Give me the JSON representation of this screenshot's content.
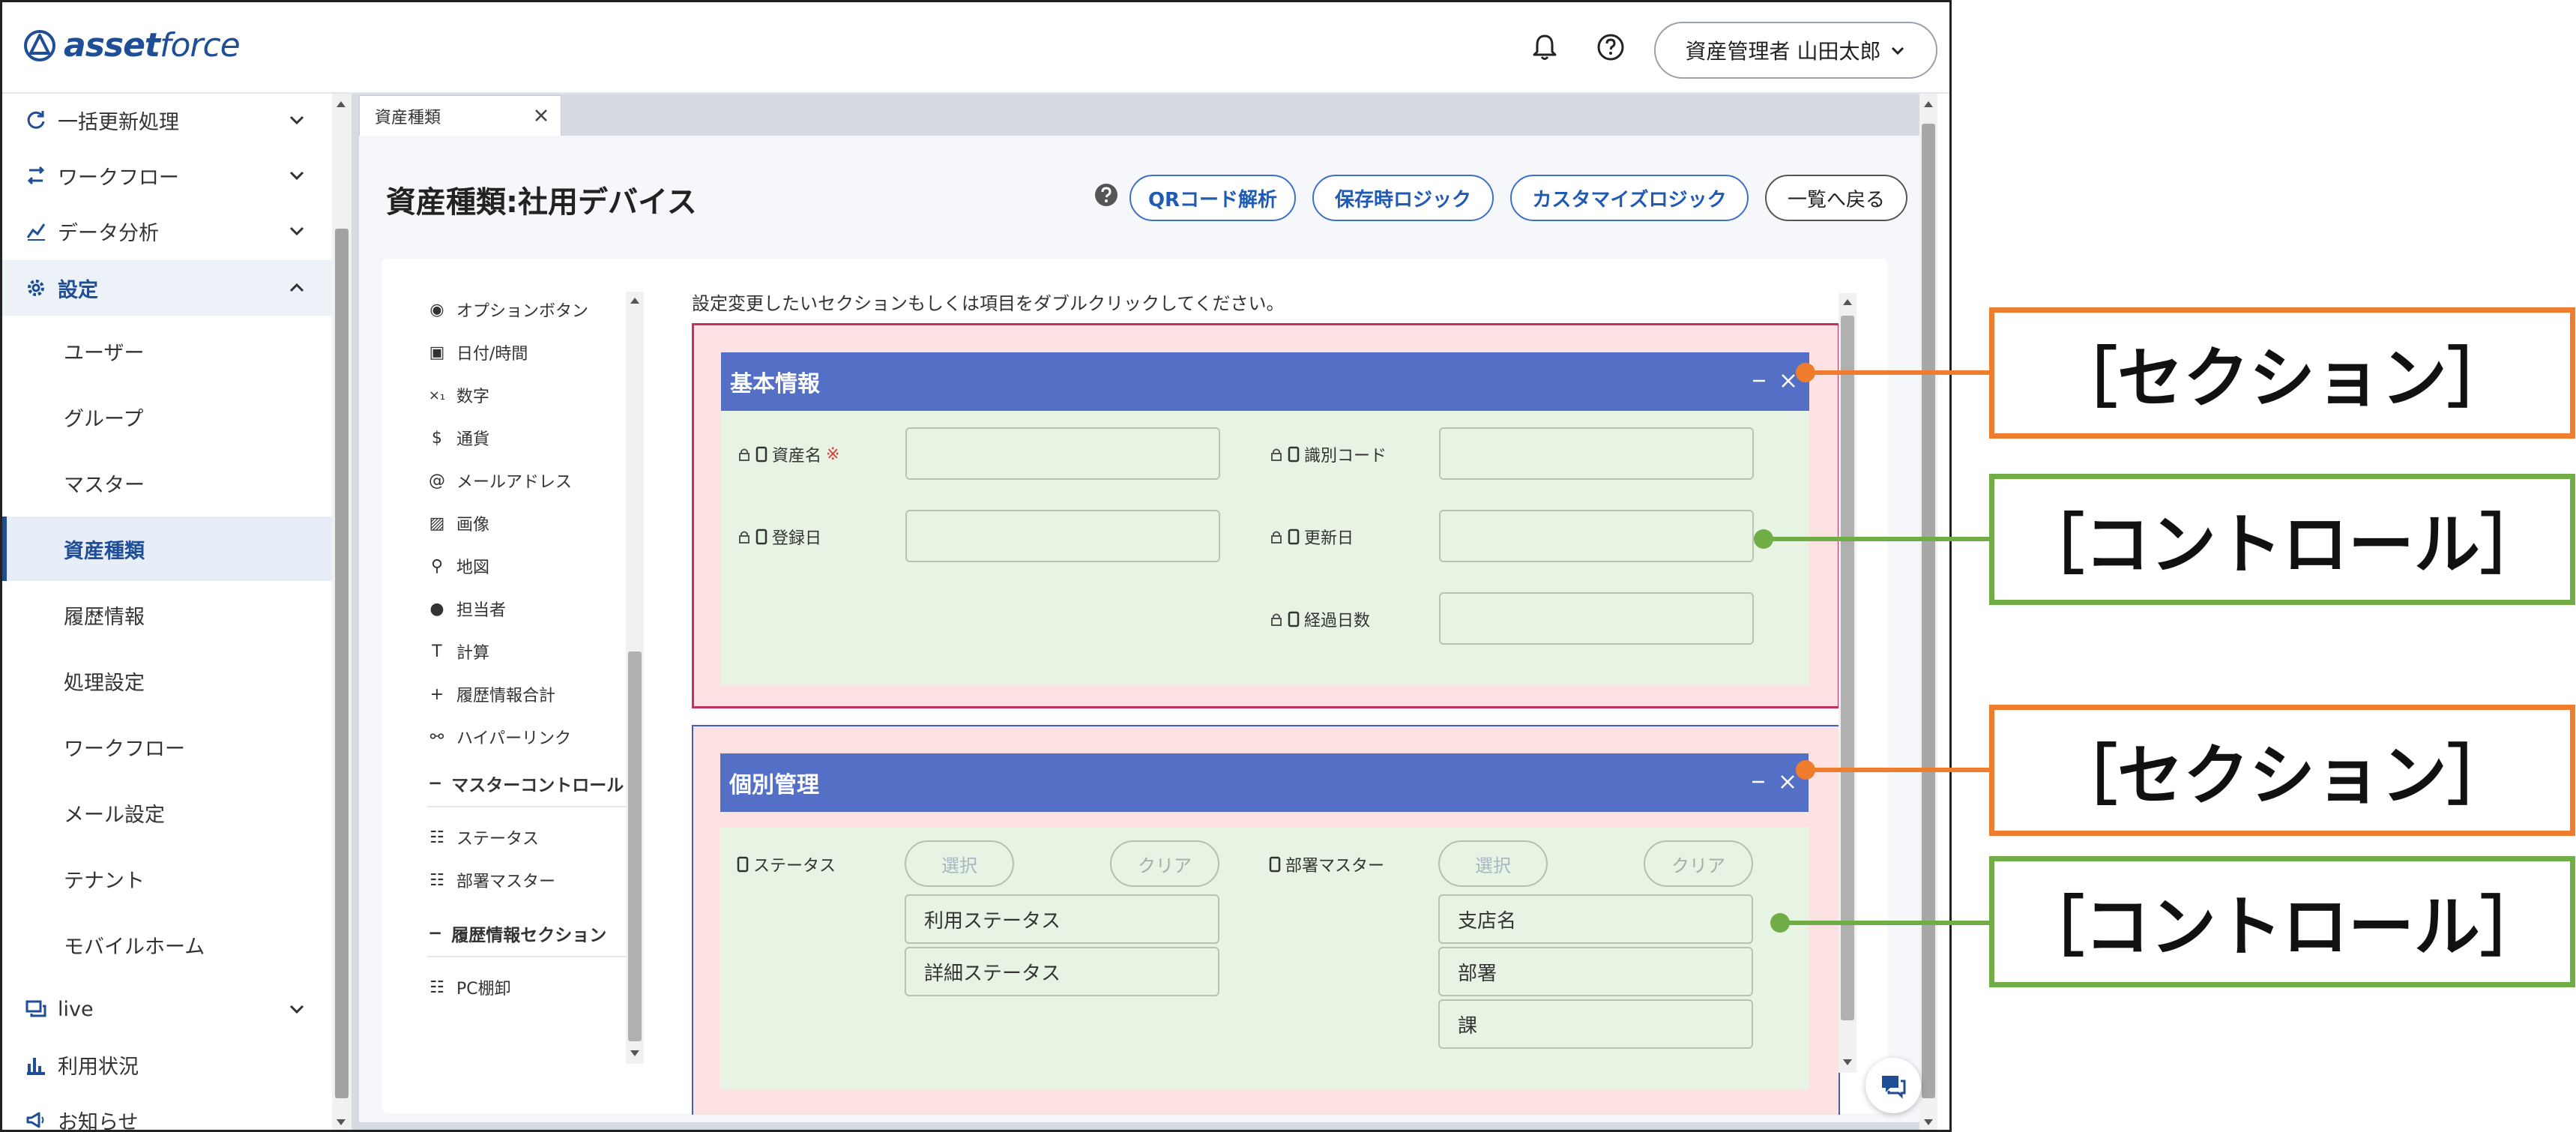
{
  "header": {
    "logo_text_bold": "asset",
    "logo_text_light": "force",
    "user_menu_label": "資産管理者 山田太郎"
  },
  "sidebar": {
    "top_items": [
      {
        "label": "一括更新処理",
        "icon": "refresh-icon"
      },
      {
        "label": "ワークフロー",
        "icon": "workflow-icon"
      },
      {
        "label": "データ分析",
        "icon": "analytics-icon"
      },
      {
        "label": "設定",
        "icon": "gear-icon"
      }
    ],
    "settings_items": [
      "ユーザー",
      "グループ",
      "マスター",
      "資産種類",
      "履歴情報",
      "処理設定",
      "ワークフロー",
      "メール設定",
      "テナント",
      "モバイルホーム"
    ],
    "bottom_items": [
      {
        "label": "live",
        "icon": "chat-icon"
      },
      {
        "label": "利用状況",
        "icon": "bar-chart-icon"
      },
      {
        "label": "お知らせ",
        "icon": "megaphone-icon"
      }
    ]
  },
  "tab": {
    "label": "資産種類"
  },
  "page": {
    "title": "資産種類:社用デバイス",
    "buttons": [
      "QRコード解析",
      "保存時ロジック",
      "カスタマイズロジック",
      "一覧へ戻る"
    ]
  },
  "palette": {
    "items": [
      "オプションボタン",
      "日付/時間",
      "数字",
      "通貨",
      "メールアドレス",
      "画像",
      "地図",
      "担当者",
      "計算",
      "履歴情報合計",
      "ハイパーリンク"
    ],
    "group_master": "マスターコントロール",
    "master_items": [
      "ステータス",
      "部署マスター"
    ],
    "group_history": "履歴情報セクション",
    "history_items": [
      "PC棚卸"
    ]
  },
  "layout": {
    "instruction": "設定変更したいセクションもしくは項目をダブルクリックしてください。",
    "section_basic": {
      "title": "基本情報",
      "fields": [
        "資産名",
        "識別コード",
        "登録日",
        "更新日",
        "経過日数"
      ],
      "required_mark": "※"
    },
    "section_indiv": {
      "title": "個別管理",
      "status_label": "ステータス",
      "dept_label": "部署マスター",
      "select_label": "選択",
      "clear_label": "クリア",
      "status_items": [
        "利用ステータス",
        "詳細ステータス"
      ],
      "dept_items": [
        "支店名",
        "部署",
        "課"
      ]
    }
  },
  "callouts": {
    "section": "［セクション］",
    "control": "［コントロール］"
  },
  "colors": {
    "brand": "#1f4e96",
    "section_header": "#5470c6",
    "callout_section": "#ef7d2d",
    "callout_control": "#70ad47"
  }
}
